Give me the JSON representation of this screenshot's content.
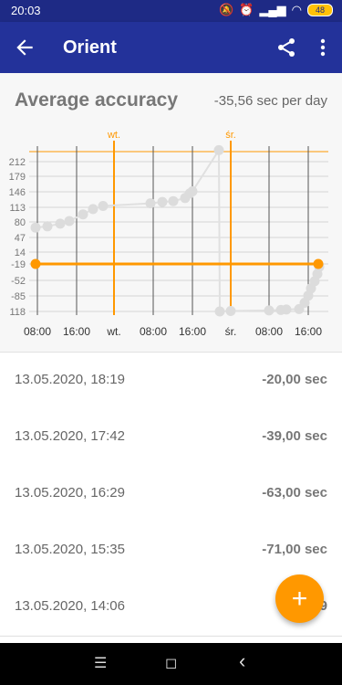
{
  "status_bar": {
    "time": "20:03",
    "battery": "48"
  },
  "app_bar": {
    "title": "Orient"
  },
  "summary": {
    "title": "Average accuracy",
    "value": "-35,56 sec per day"
  },
  "chart_data": {
    "type": "line",
    "ylabel": "",
    "xlabel": "",
    "y_ticks": [
      212,
      179,
      146,
      113,
      80,
      47,
      14,
      -19,
      -52,
      -85,
      118
    ],
    "x_ticks": [
      "08:00",
      "16:00",
      "wt.",
      "08:00",
      "16:00",
      "śr.",
      "08:00",
      "16:00"
    ],
    "day_markers": [
      "wt.",
      "śr."
    ],
    "average_line": -19,
    "series": [
      {
        "values": [
          63,
          66,
          72,
          78,
          93,
          105,
          112,
          118,
          121,
          123,
          130,
          140,
          145,
          238,
          -118,
          -117,
          -116,
          -115,
          -114,
          -113,
          -100,
          -85,
          -70,
          -55,
          -40,
          -25
        ]
      }
    ],
    "colors": {
      "points": "#dcdcdc",
      "average": "#ff9800",
      "grid": "#444444"
    }
  },
  "measurements": [
    {
      "date": "13.05.2020, 18:19",
      "value": "-20,00 sec"
    },
    {
      "date": "13.05.2020, 17:42",
      "value": "-39,00 sec"
    },
    {
      "date": "13.05.2020, 16:29",
      "value": "-63,00 sec"
    },
    {
      "date": "13.05.2020, 15:35",
      "value": "-71,00 sec"
    },
    {
      "date": "13.05.2020, 14:06",
      "value": "-9"
    }
  ],
  "fab": {
    "label": "+"
  },
  "nav": {
    "menu": "☰",
    "home": "◻",
    "back": "‹"
  }
}
